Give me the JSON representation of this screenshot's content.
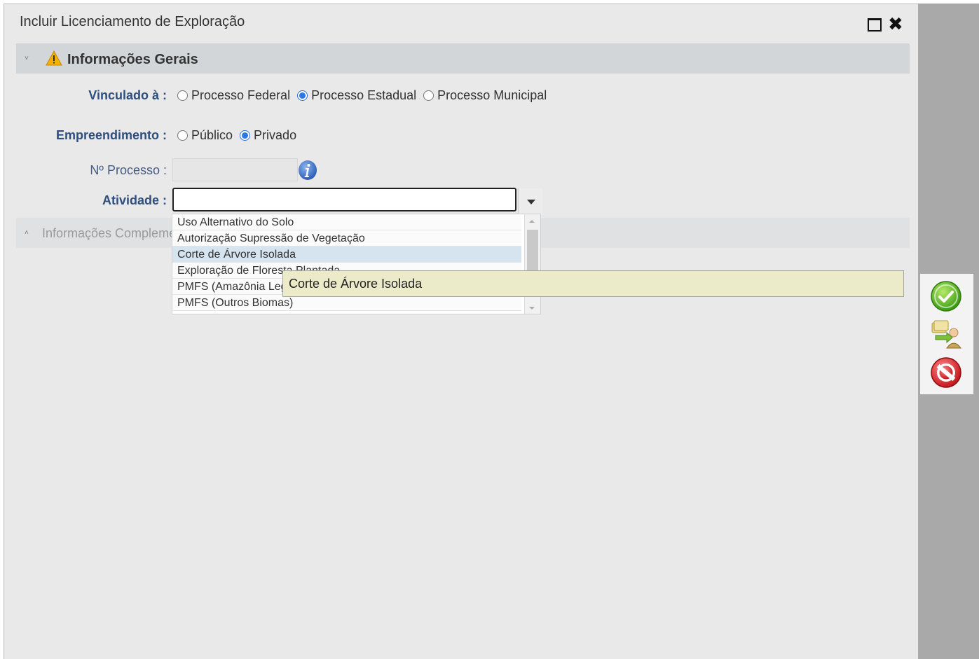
{
  "dialog": {
    "title": "Incluir Licenciamento de Exploração"
  },
  "sections": {
    "general": {
      "toggle": "˅",
      "label": "Informações Gerais"
    },
    "complementary": {
      "toggle": "˄",
      "label": "Informações Complementares"
    }
  },
  "form": {
    "vinculado": {
      "label": "Vinculado à :",
      "options": [
        "Processo Federal",
        "Processo Estadual",
        "Processo Municipal"
      ],
      "selected": "Processo Estadual"
    },
    "empreendimento": {
      "label": "Empreendimento :",
      "options": [
        "Público",
        "Privado"
      ],
      "selected": "Privado"
    },
    "processo": {
      "label": "Nº Processo :",
      "value": ""
    },
    "atividade": {
      "label": "Atividade :",
      "value": "",
      "options": [
        "Uso Alternativo do Solo",
        "Autorização Supressão de Vegetação",
        "Corte de Árvore Isolada",
        "Exploração de Floresta Plantada",
        "PMFS (Amazônia Legal)",
        "PMFS (Outros Biomas)"
      ],
      "highlighted": "Corte de Árvore Isolada"
    }
  },
  "tooltip": {
    "text": "Corte de Árvore Isolada"
  },
  "colors": {
    "label": "#2e4e7e",
    "radio_checked": "#2b78e4",
    "section_bar": "#d2d6d9",
    "tooltip_bg": "#ecebc9",
    "ok": "#4caf1a",
    "cancel": "#d9282f"
  },
  "icons": {
    "warning": "warning-icon",
    "info": "info-icon",
    "maximize": "maximize-icon",
    "close": "close-icon",
    "confirm": "check-circle-icon",
    "transfer": "transfer-user-icon",
    "cancel": "forbidden-icon"
  }
}
